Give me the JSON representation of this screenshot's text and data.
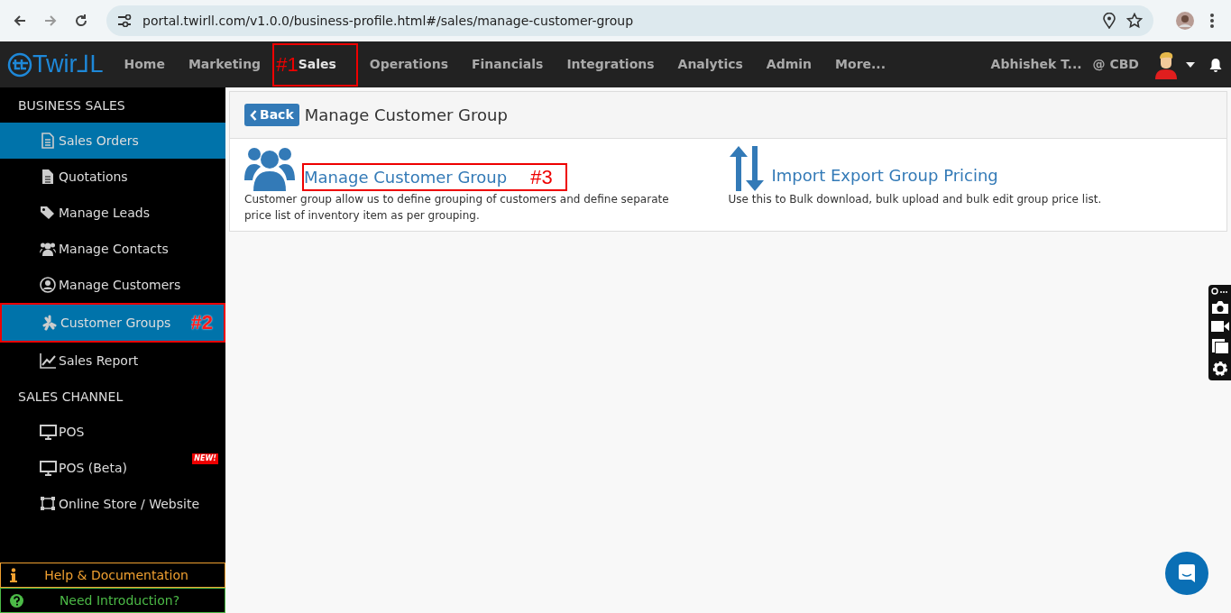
{
  "browser": {
    "url": "portal.twirll.com/v1.0.0/business-profile.html#/sales/manage-customer-group"
  },
  "navbar": {
    "logo": "Twir⅃L",
    "items": [
      {
        "label": "Home",
        "selected": false
      },
      {
        "label": "Marketing",
        "selected": false
      },
      {
        "label": "Sales",
        "selected": true,
        "callout": "#1"
      },
      {
        "label": "Operations",
        "selected": false
      },
      {
        "label": "Financials",
        "selected": false
      },
      {
        "label": "Integrations",
        "selected": false
      },
      {
        "label": "Analytics",
        "selected": false
      },
      {
        "label": "Admin",
        "selected": false
      },
      {
        "label": "More...",
        "selected": false
      }
    ],
    "user": "Abhishek T...",
    "business": "@ CBD"
  },
  "sidebar": {
    "sections": [
      {
        "title": "BUSINESS SALES",
        "items": [
          {
            "label": "Sales Orders",
            "selected": true
          },
          {
            "label": "Quotations",
            "selected": false
          },
          {
            "label": "Manage Leads",
            "selected": false
          },
          {
            "label": "Manage Contacts",
            "selected": false
          },
          {
            "label": "Manage Customers",
            "selected": false
          },
          {
            "label": "Customer Groups",
            "selected": true,
            "callout": "#2"
          },
          {
            "label": "Sales Report",
            "selected": false
          }
        ]
      },
      {
        "title": "SALES CHANNEL",
        "items": [
          {
            "label": "POS",
            "selected": false
          },
          {
            "label": "POS (Beta)",
            "selected": false,
            "badge": "NEW!"
          },
          {
            "label": "Online Store / Website",
            "selected": false
          }
        ]
      }
    ],
    "footer": [
      {
        "label": "Help & Documentation",
        "kind": "help"
      },
      {
        "label": "Need Introduction?",
        "kind": "intro"
      }
    ]
  },
  "panel": {
    "back": "Back",
    "title": "Manage Customer Group",
    "tiles": [
      {
        "title": "Manage Customer Group",
        "callout": "#3",
        "description": "Customer group allow us to define grouping of customers and define separate price list of inventory item as per grouping."
      },
      {
        "title": "Import Export Group Pricing",
        "description": "Use this to Bulk download, bulk upload and bulk edit group price list."
      }
    ]
  }
}
